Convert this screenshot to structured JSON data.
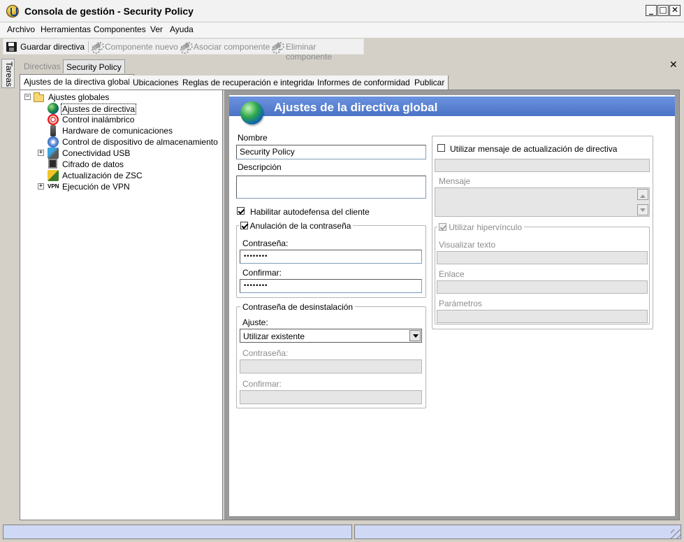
{
  "window": {
    "title": "Consola de gestión - Security Policy"
  },
  "menu": [
    "Archivo",
    "Herramientas",
    "Componentes",
    "Ver",
    "Ayuda"
  ],
  "toolbar": {
    "save": "Guardar directiva",
    "new_component": "Componente nuevo",
    "associate_component": "Asociar componente",
    "delete_component": "Eliminar componente"
  },
  "side_tab": "Tareas",
  "doc_tabs": {
    "directivas": "Directivas",
    "current": "Security Policy"
  },
  "panel_tabs": [
    "Ajustes de la directiva global",
    "Ubicaciones",
    "Reglas de recuperación e integridad",
    "Informes de conformidad",
    "Publicar"
  ],
  "tree": {
    "root": "Ajustes globales",
    "items": [
      {
        "label": "Ajustes de directiva",
        "icon": "globe-icon"
      },
      {
        "label": "Control inalámbrico",
        "icon": "wireless-icon"
      },
      {
        "label": "Hardware de comunicaciones",
        "icon": "hardware-icon"
      },
      {
        "label": "Control de dispositivo de almacenamiento",
        "icon": "disk-icon"
      },
      {
        "label": "Conectividad USB",
        "icon": "usb-icon"
      },
      {
        "label": "Cifrado de datos",
        "icon": "encryption-icon"
      },
      {
        "label": "Actualización de ZSC",
        "icon": "zsc-update-icon"
      },
      {
        "label": "Ejecución de VPN",
        "icon": "vpn-icon"
      }
    ]
  },
  "form": {
    "header_title": "Ajustes de la directiva global",
    "name_label": "Nombre",
    "name_value": "Security Policy",
    "description_label": "Descripción",
    "description_value": "",
    "self_defense_label": "Habilitar autodefensa del cliente",
    "self_defense_checked": true,
    "override_label": "Anulación de la contraseña",
    "override_checked": true,
    "password_label": "Contraseña:",
    "password_value": "••••••••",
    "confirm_label": "Confirmar:",
    "confirm_value": "••••••••",
    "uninstall_group": "Contraseña de desinstalación",
    "setting_label": "Ajuste:",
    "setting_value": "Utilizar existente",
    "u_password_label": "Contraseña:",
    "u_confirm_label": "Confirmar:",
    "update_msg_label": "Utilizar mensaje de actualización de directiva",
    "message_label": "Mensaje",
    "hyperlink_label": "Utilizar hipervínculo",
    "display_text_label": "Visualizar texto",
    "link_label": "Enlace",
    "parameters_label": "Parámetros"
  }
}
